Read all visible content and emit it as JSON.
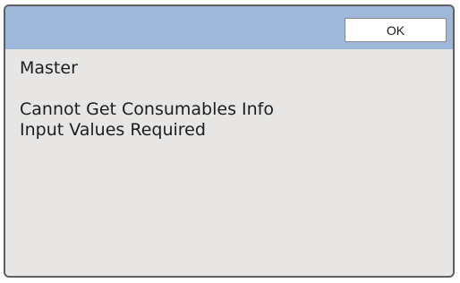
{
  "dialog": {
    "ok_label": "OK",
    "category": "Master",
    "message_lines": [
      "Cannot Get Consumables Info",
      "Input Values Required"
    ]
  },
  "colors": {
    "title_bar": "#9fb8da",
    "panel_background": "#e7e6e4",
    "frame": "#5f5f5f",
    "button_background": "#ffffff"
  }
}
